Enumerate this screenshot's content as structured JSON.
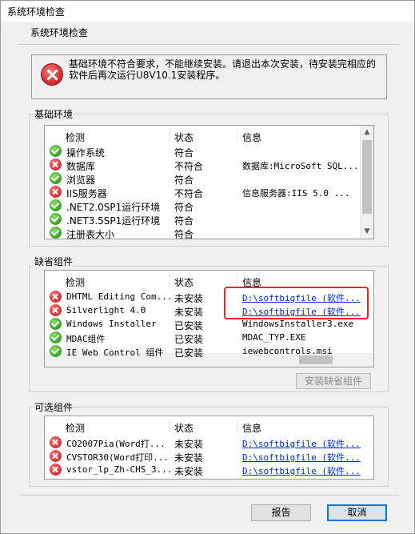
{
  "window": {
    "title": "系统环境检查"
  },
  "subtitle": "系统环境检查",
  "error_message": "基础环境不符合要求，不能继续安装。请退出本次安装，待安装完相应的软件后再次运行U8V10.1安装程序。",
  "columns": {
    "check": "检测",
    "status": "状态",
    "info": "信息"
  },
  "basic": {
    "label": "基础环境",
    "rows": [
      {
        "icon": "ok",
        "name": "操作系统",
        "status": "符合",
        "info": ""
      },
      {
        "icon": "err",
        "name": "数据库",
        "status": "不符合",
        "info": "数据库:MicroSoft SQL..."
      },
      {
        "icon": "ok",
        "name": "浏览器",
        "status": "符合",
        "info": ""
      },
      {
        "icon": "err",
        "name": "IIS服务器",
        "status": "不符合",
        "info": "信息服务器:IIS 5.0 ..."
      },
      {
        "icon": "ok",
        "name": ".NET2.0SP1运行环境",
        "status": "符合",
        "info": ""
      },
      {
        "icon": "ok",
        "name": ".NET3.5SP1运行环境",
        "status": "符合",
        "info": ""
      },
      {
        "icon": "ok",
        "name": "注册表大小",
        "status": "符合",
        "info": ""
      }
    ]
  },
  "missing": {
    "label": "缺省组件",
    "install_button": "安装缺省组件",
    "rows": [
      {
        "icon": "err",
        "name": "DHTML Editing Com...",
        "status": "未安装",
        "info": "D:\\softbigfile (软件...",
        "link": true
      },
      {
        "icon": "err",
        "name": "Silverlight 4.0",
        "status": "未安装",
        "info": "D:\\softbigfile (软件...",
        "link": true
      },
      {
        "icon": "ok",
        "name": "Windows Installer",
        "status": "已安装",
        "info": "WindowsInstaller3.exe",
        "link": false
      },
      {
        "icon": "ok",
        "name": "MDAC组件",
        "status": "已安装",
        "info": "MDAC_TYP.EXE",
        "link": false
      },
      {
        "icon": "ok",
        "name": "IE Web Control 组件",
        "status": "已安装",
        "info": "iewebcontrols.msi",
        "link": false
      }
    ]
  },
  "optional": {
    "label": "可选组件",
    "rows": [
      {
        "icon": "err",
        "name": "CO2007Pia(Word打...",
        "status": "未安装",
        "info": "D:\\softbigfile (软件...",
        "link": true
      },
      {
        "icon": "err",
        "name": "CVSTOR30(Word打印...",
        "status": "未安装",
        "info": "D:\\softbigfile (软件...",
        "link": true
      },
      {
        "icon": "err",
        "name": "vstor_lp_Zh-CHS_3...",
        "status": "未安装",
        "info": "D:\\softbigfile (软件...",
        "link": true
      }
    ]
  },
  "buttons": {
    "report": "报告",
    "cancel": "取消"
  }
}
